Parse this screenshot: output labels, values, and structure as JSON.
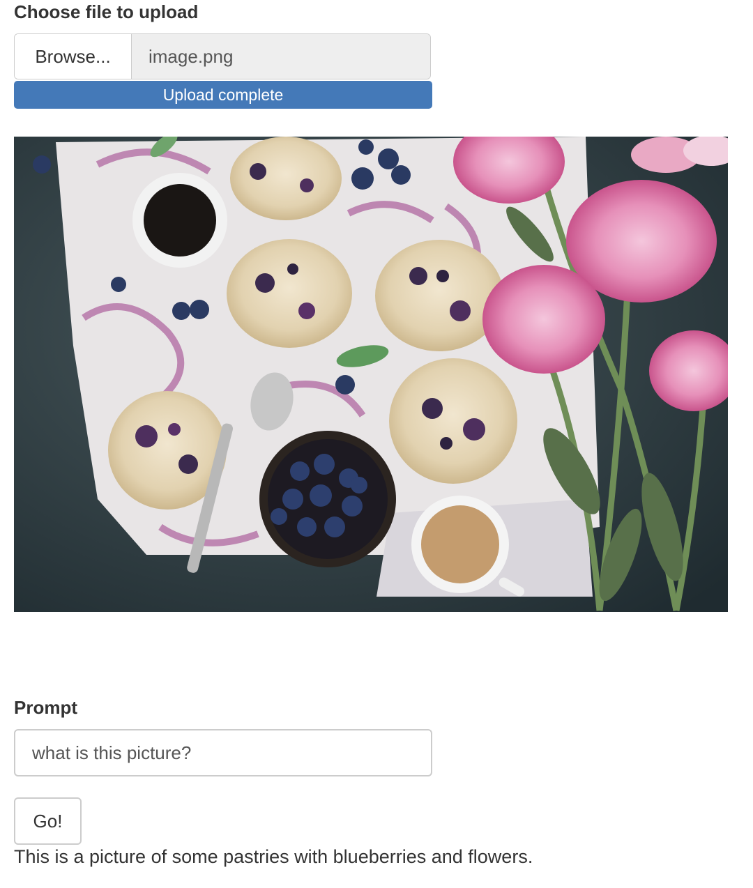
{
  "upload": {
    "label": "Choose file to upload",
    "browse_label": "Browse...",
    "file_name": "image.png",
    "progress_text": "Upload complete",
    "progress_percent": 100
  },
  "image": {
    "description_icon": "photo-pastries-blueberries-flowers"
  },
  "prompt": {
    "label": "Prompt",
    "value": "what is this picture?"
  },
  "go_button": {
    "label": "Go!"
  },
  "result": {
    "text": "This is a picture of some pastries with blueberries and flowers."
  },
  "colors": {
    "progress_fill": "#4479b8",
    "border": "#cccccc",
    "file_name_bg": "#eeeeee"
  }
}
